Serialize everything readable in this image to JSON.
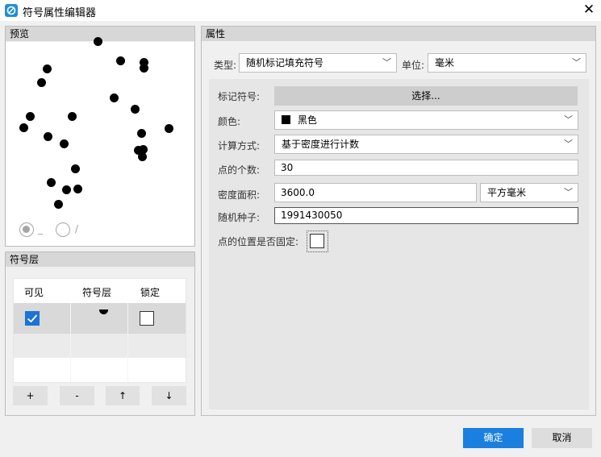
{
  "window": {
    "title": "符号属性编辑器",
    "close_glyph": "✕",
    "icon": "app-logo-icon"
  },
  "preview": {
    "header": "预览",
    "radio_options": [
      {
        "label": "_",
        "selected": true
      },
      {
        "label": "/",
        "selected": false
      }
    ]
  },
  "layers": {
    "header": "符号层",
    "columns": [
      "可见",
      "符号层",
      "锁定"
    ],
    "rows": [
      {
        "visible": true,
        "locked": false
      }
    ],
    "buttons": {
      "add": "+",
      "remove": "-",
      "up": "↑",
      "down": "↓"
    }
  },
  "properties": {
    "header": "属性",
    "type_label": "类型:",
    "type_value": "随机标记填充符号",
    "unit_label": "单位:",
    "unit_value": "毫米",
    "marker_label": "标记符号:",
    "marker_button": "选择...",
    "color_label": "颜色:",
    "color_value": "黑色",
    "color_swatch": "#000000",
    "calc_label": "计算方式:",
    "calc_value": "基于密度进行计数",
    "count_label": "点的个数:",
    "count_value": "30",
    "area_label": "密度面积:",
    "area_value": "3600.0",
    "area_unit": "平方毫米",
    "seed_label": "随机种子:",
    "seed_value": "1991430050",
    "fixed_label": "点的位置是否固定:",
    "fixed_checked": false
  },
  "footer": {
    "ok": "确定",
    "cancel": "取消"
  },
  "colors": {
    "accent": "#1b7fdf",
    "checkbox_on": "#1b74d6"
  }
}
